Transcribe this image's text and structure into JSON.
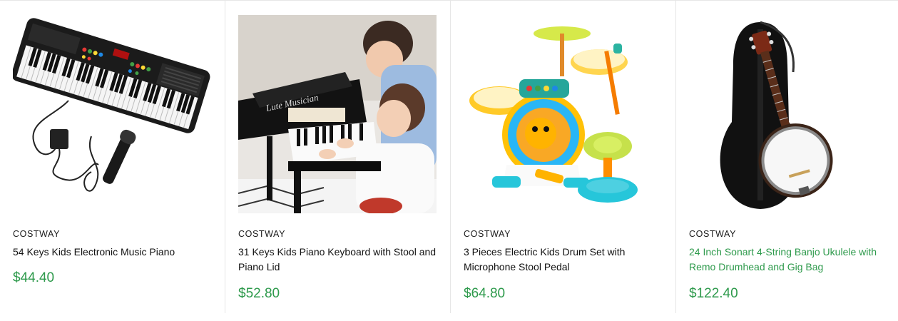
{
  "products": [
    {
      "brand": "COSTWAY",
      "title": "54 Keys Kids Electronic Music Piano",
      "price": "$44.40"
    },
    {
      "brand": "COSTWAY",
      "title": "31 Keys Kids Piano Keyboard with Stool and Piano Lid",
      "price": "$52.80",
      "piano_logo": "Lute Musician"
    },
    {
      "brand": "COSTWAY",
      "title": "3 Pieces Electric Kids Drum Set with Microphone Stool Pedal",
      "price": "$64.80"
    },
    {
      "brand": "COSTWAY",
      "title": "24 Inch Sonart 4-String Banjo Ukulele with Remo Drumhead and Gig Bag",
      "price": "$122.40"
    }
  ],
  "colors": {
    "price": "#2e9a4c",
    "hover_title": "#2e9a4c",
    "divider": "#e6e6e6"
  }
}
